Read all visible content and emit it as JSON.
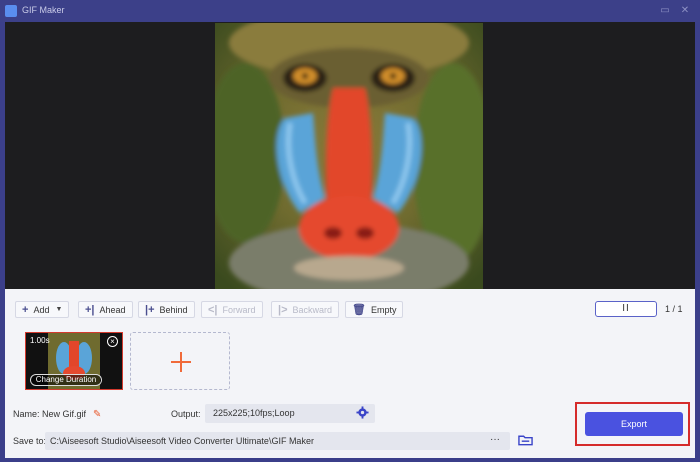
{
  "window": {
    "title": "GIF Maker",
    "minimize_icon": "minimize-icon",
    "close_icon": "close-icon"
  },
  "toolbar": {
    "add_label": "Add",
    "ahead_label": "Ahead",
    "behind_label": "Behind",
    "forward_label": "Forward",
    "backward_label": "Backward",
    "empty_label": "Empty",
    "pause_symbol": "II",
    "page_indicator": "1 / 1"
  },
  "timeline": {
    "frames": [
      {
        "duration": "1.00s",
        "button_label": "Change Duration"
      }
    ]
  },
  "settings": {
    "name_label": "Name:",
    "name_value": "New Gif.gif",
    "output_label": "Output:",
    "output_value": "225x225;10fps;Loop",
    "save_label": "Save to:",
    "save_path": "C:\\Aiseesoft Studio\\Aiseesoft Video Converter Ultimate\\GIF Maker",
    "more_symbol": "···"
  },
  "export": {
    "label": "Export"
  },
  "colors": {
    "accent": "#4a52e0",
    "highlight": "#d52b2b",
    "titlebar": "#3c4089",
    "edit": "#e8572a"
  }
}
